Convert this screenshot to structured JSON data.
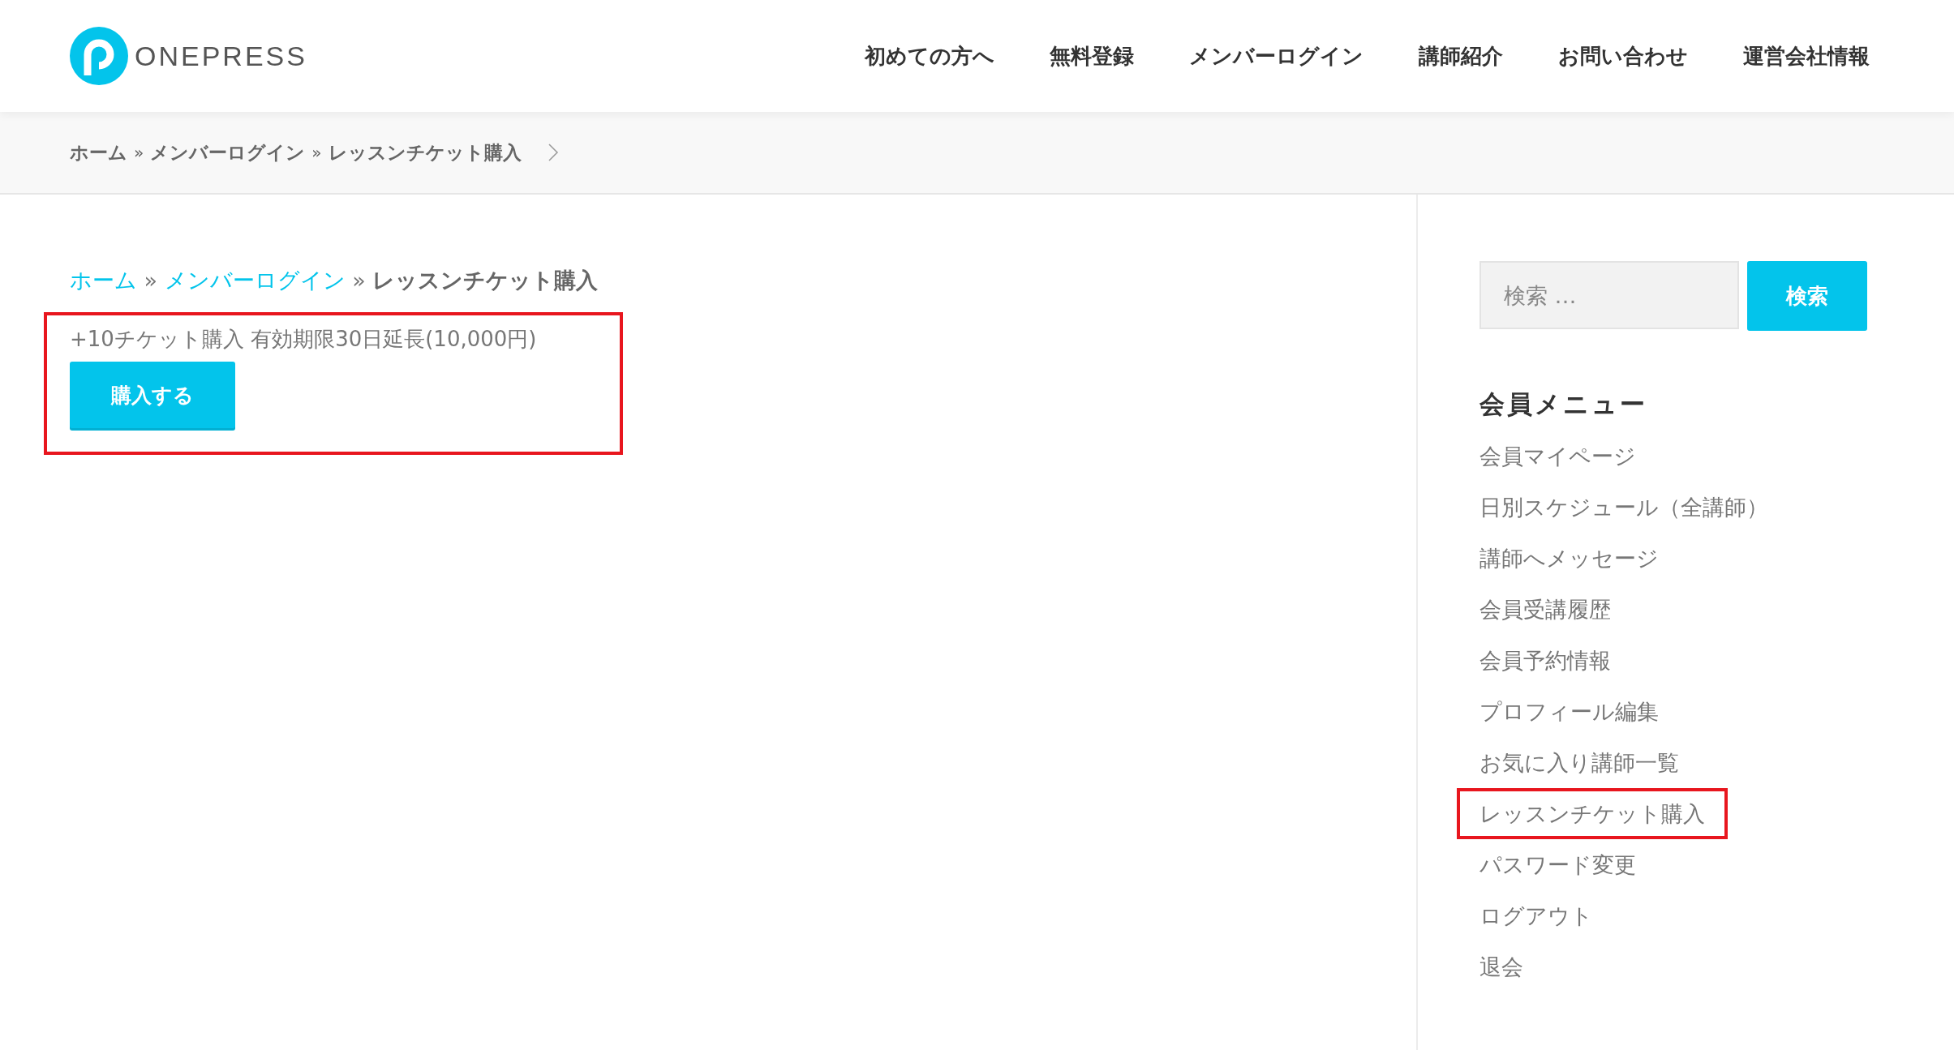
{
  "header": {
    "logo_text": "ONEPRESS",
    "nav": [
      {
        "label": "初めての方へ"
      },
      {
        "label": "無料登録"
      },
      {
        "label": "メンバーログイン"
      },
      {
        "label": "講師紹介"
      },
      {
        "label": "お問い合わせ"
      },
      {
        "label": "運営会社情報"
      }
    ]
  },
  "top_breadcrumb": {
    "items": [
      "ホーム",
      "メンバーログイン",
      "レッスンチケット購入"
    ],
    "separator": "»"
  },
  "main": {
    "breadcrumb": {
      "items": [
        {
          "label": "ホーム",
          "link": true
        },
        {
          "label": "メンバーログイン",
          "link": true
        },
        {
          "label": "レッスンチケット購入",
          "link": false
        }
      ],
      "separator": "»"
    },
    "purchase": {
      "highlighted": true,
      "description": "+10チケット購入 有効期限30日延長(10,000円)",
      "button": "購入する"
    }
  },
  "sidebar": {
    "search": {
      "placeholder": "検索 …",
      "button": "検索"
    },
    "menu_title": "会員メニュー",
    "menu": [
      {
        "label": "会員マイページ",
        "highlighted": false
      },
      {
        "label": "日別スケジュール（全講師）",
        "highlighted": false
      },
      {
        "label": "講師へメッセージ",
        "highlighted": false
      },
      {
        "label": "会員受講履歴",
        "highlighted": false
      },
      {
        "label": "会員予約情報",
        "highlighted": false
      },
      {
        "label": "プロフィール編集",
        "highlighted": false
      },
      {
        "label": "お気に入り講師一覧",
        "highlighted": false
      },
      {
        "label": "レッスンチケット購入",
        "highlighted": true
      },
      {
        "label": "パスワード変更",
        "highlighted": false
      },
      {
        "label": "ログアウト",
        "highlighted": false
      },
      {
        "label": "退会",
        "highlighted": false
      }
    ]
  }
}
